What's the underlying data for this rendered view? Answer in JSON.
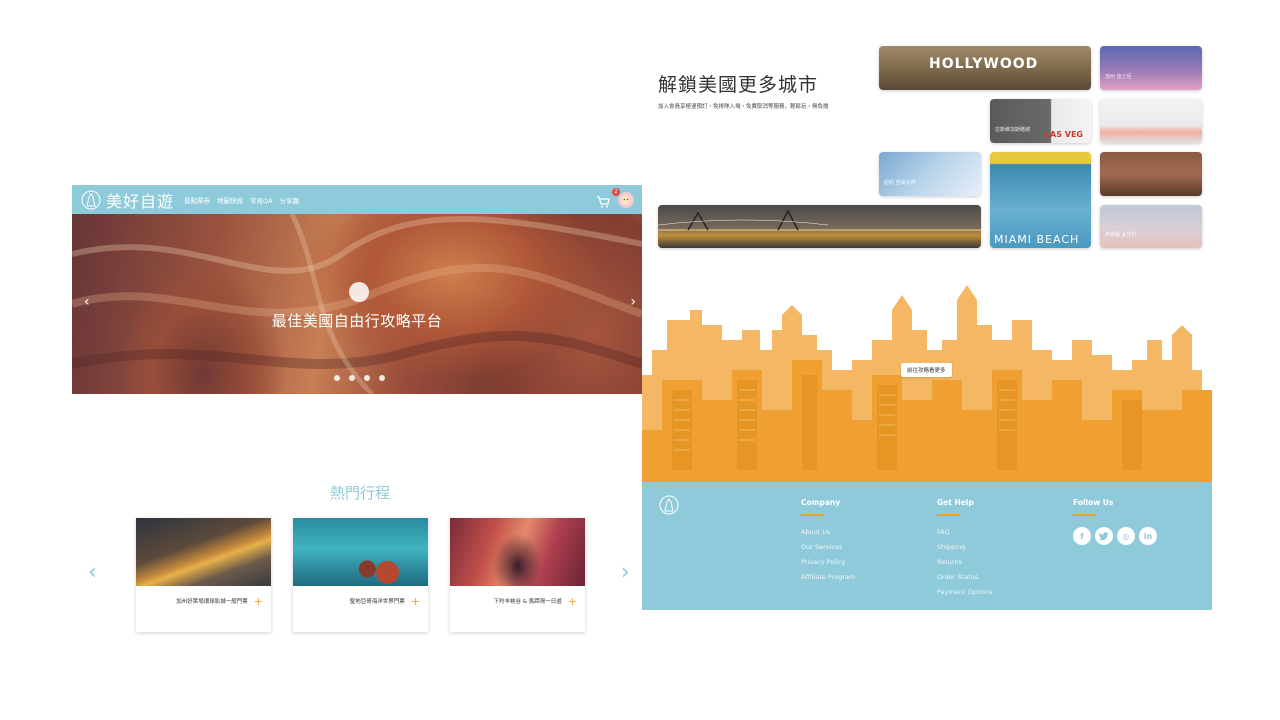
{
  "header": {
    "logo_text": "美好自遊",
    "nav_items": [
      "景點票券",
      "地圖快搜",
      "常見QA",
      "分享趣"
    ],
    "cart_count": "2"
  },
  "hero": {
    "title": "最佳美國自由行攻略平台",
    "prev": "‹",
    "next": "›",
    "slide_count": 4,
    "active_slide": 1
  },
  "popular": {
    "title": "熱門行程",
    "prev": "‹",
    "next": "›",
    "trips": [
      {
        "name": "加州好萊塢環球影城一般門票",
        "add": "+"
      },
      {
        "name": "聖地亞哥海洋世界門票",
        "add": "+"
      },
      {
        "name": "下羚羊峽谷 & 馬蹄灣一日遊",
        "add": "+"
      }
    ]
  },
  "cities": {
    "title": "解鎖美國更多城市",
    "subtitle": "加入會員享極速預訂・免排隊入場・免費取消等服務，輕鬆玩・無負擔",
    "tiles": {
      "hollywood": {
        "image_text": "HOLLYWOOD"
      },
      "disney": {
        "label": "加州 迪士尼"
      },
      "lasvegas": {
        "label": "拉斯維加斯賭城",
        "image_text": "LAS VEG"
      },
      "nyc": {
        "label": "紐約 自由女神"
      },
      "miami": {
        "image_text": "MIAMI BEACH"
      },
      "seattle": {
        "label": "西雅圖 太空針"
      }
    }
  },
  "cta": {
    "label": "前往攻略看更多"
  },
  "footer": {
    "columns": [
      {
        "title": "Company",
        "links": [
          "About Us",
          "Our Services",
          "Privacy Policy",
          "Affiliate Program"
        ]
      },
      {
        "title": "Get Help",
        "links": [
          "FAQ",
          "Shipping",
          "Returns",
          "Order Status",
          "Payment Options"
        ]
      },
      {
        "title": "Follow Us",
        "social": [
          "f",
          "t",
          "◎",
          "in"
        ]
      }
    ]
  },
  "colors": {
    "primary": "#8ecad9",
    "accent": "#f0a030",
    "skyline": "#f0a030",
    "badge": "#e14b4b"
  }
}
